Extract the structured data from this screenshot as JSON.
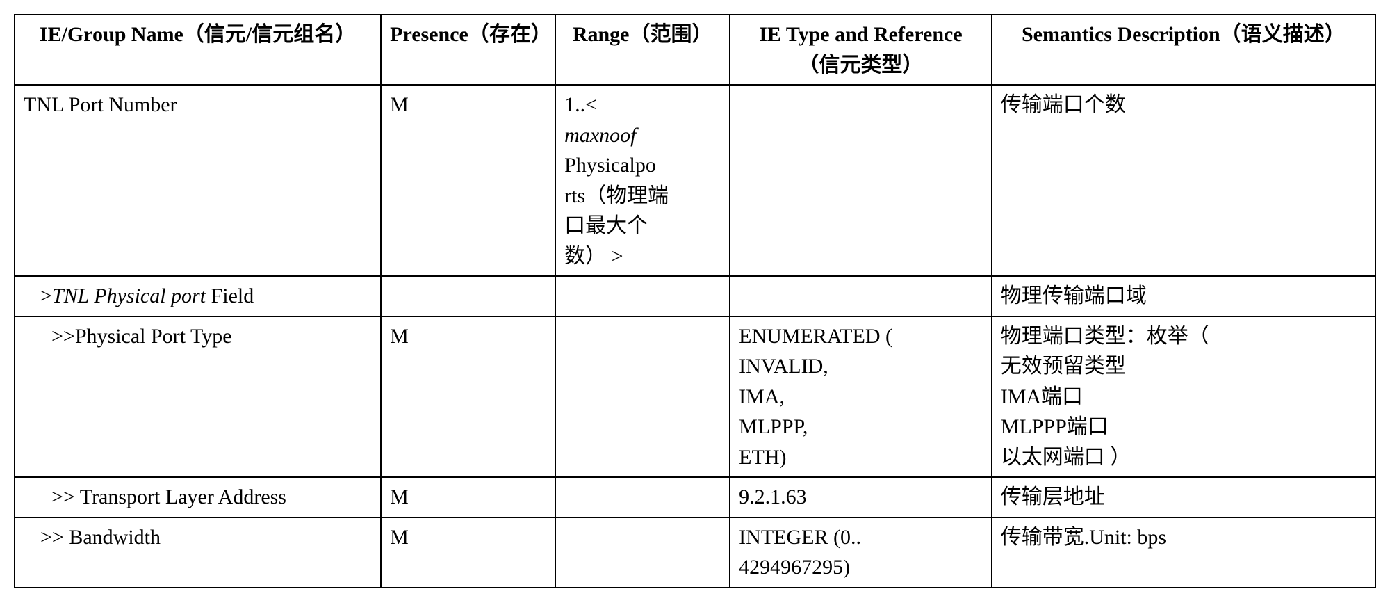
{
  "headers": {
    "col1": "IE/Group Name（信元/信元组名）",
    "col2": "Presence（存在）",
    "col3": "Range（范围）",
    "col4": "IE Type and Reference（信元类型）",
    "col5": "Semantics Description（语义描述）"
  },
  "rows": {
    "r1": {
      "name": "TNL Port Number",
      "presence": "M",
      "range_prefix": "1..<",
      "range_italic": "maxnoof",
      "range_suffix1": "Physicalpo",
      "range_suffix2": "rts（物理端",
      "range_suffix3": "口最大个",
      "range_suffix4": "数） >",
      "type": "",
      "semantics": "传输端口个数"
    },
    "r2": {
      "name_prefix": ">",
      "name_italic": "TNL Physical port",
      "name_suffix": " Field",
      "presence": "",
      "range": "",
      "type": "",
      "semantics": "物理传输端口域"
    },
    "r3": {
      "name": ">>Physical Port Type",
      "presence": "M",
      "range": "",
      "type_l1": "ENUMERATED (",
      "type_l2": "INVALID,",
      "type_l3": "IMA,",
      "type_l4": "MLPPP,",
      "type_l5": "ETH)",
      "sem_l1": "物理端口类型：枚举（",
      "sem_l2": "无效预留类型",
      "sem_l3": "IMA端口",
      "sem_l4": "MLPPP端口",
      "sem_l5": "以太网端口 ）"
    },
    "r4": {
      "name": ">> Transport Layer Address",
      "presence": "M",
      "range": "",
      "type": "9.2.1.63",
      "semantics": "传输层地址"
    },
    "r5": {
      "name": ">> Bandwidth",
      "presence": "M",
      "range": "",
      "type_l1": "INTEGER (0..",
      "type_l2": "4294967295)",
      "semantics": "传输带宽.Unit: bps"
    }
  }
}
